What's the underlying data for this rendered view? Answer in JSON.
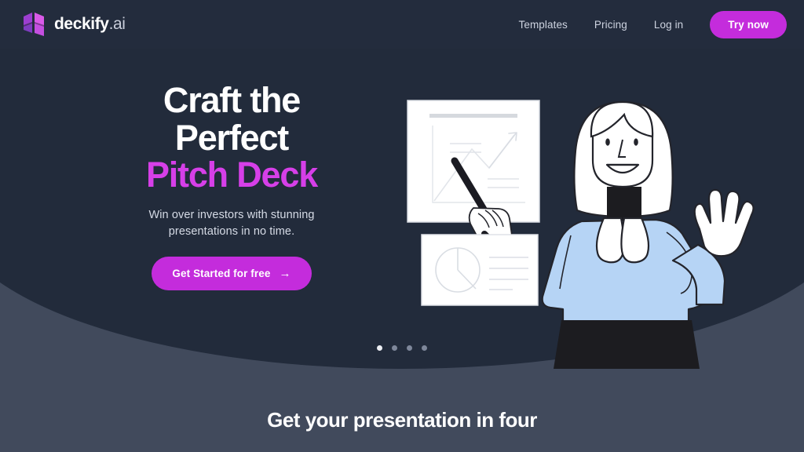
{
  "brand": {
    "name": "deckify",
    "suffix": ".ai",
    "logo_icon": "deck-cube-logo-icon",
    "colors": {
      "light": "#d95ae8",
      "mid": "#b03fd4",
      "dark": "#8b3ec4"
    }
  },
  "nav": {
    "links": [
      {
        "label": "Templates",
        "name": "nav-link-templates"
      },
      {
        "label": "Pricing",
        "name": "nav-link-pricing"
      },
      {
        "label": "Log in",
        "name": "nav-link-login"
      }
    ],
    "cta": {
      "label": "Try now",
      "color": "#c42cdc"
    }
  },
  "hero": {
    "headline_line1": "Craft the",
    "headline_line2": "Perfect",
    "headline_accent": "Pitch Deck",
    "accent_color": "#d63fe8",
    "subtitle": "Win over investors with stunning presentations in no time.",
    "cta": {
      "label": "Get Started for free",
      "arrow": "→",
      "color": "#c42cdc"
    },
    "background_color": "#222b3b"
  },
  "illustration": {
    "name": "presenter-with-slides-illustration",
    "slide_chart": {
      "name": "line-chart-slide",
      "title_bar": true,
      "has_up_arrow": true,
      "text_lines": 4
    },
    "slide_pie": {
      "name": "pie-chart-slide",
      "text_lines": 4
    },
    "character": {
      "name": "presenter-character",
      "hair_color": "#ffffff",
      "blouse_color": "#b6d4f5",
      "skirt_color": "#1c1c20",
      "gesture": "waving-hand",
      "holding": "pointer-stick"
    }
  },
  "carousel": {
    "total": 4,
    "active_index": 0
  },
  "next_section": {
    "title": "Get your presentation in four",
    "background_color": "#414a5c"
  }
}
